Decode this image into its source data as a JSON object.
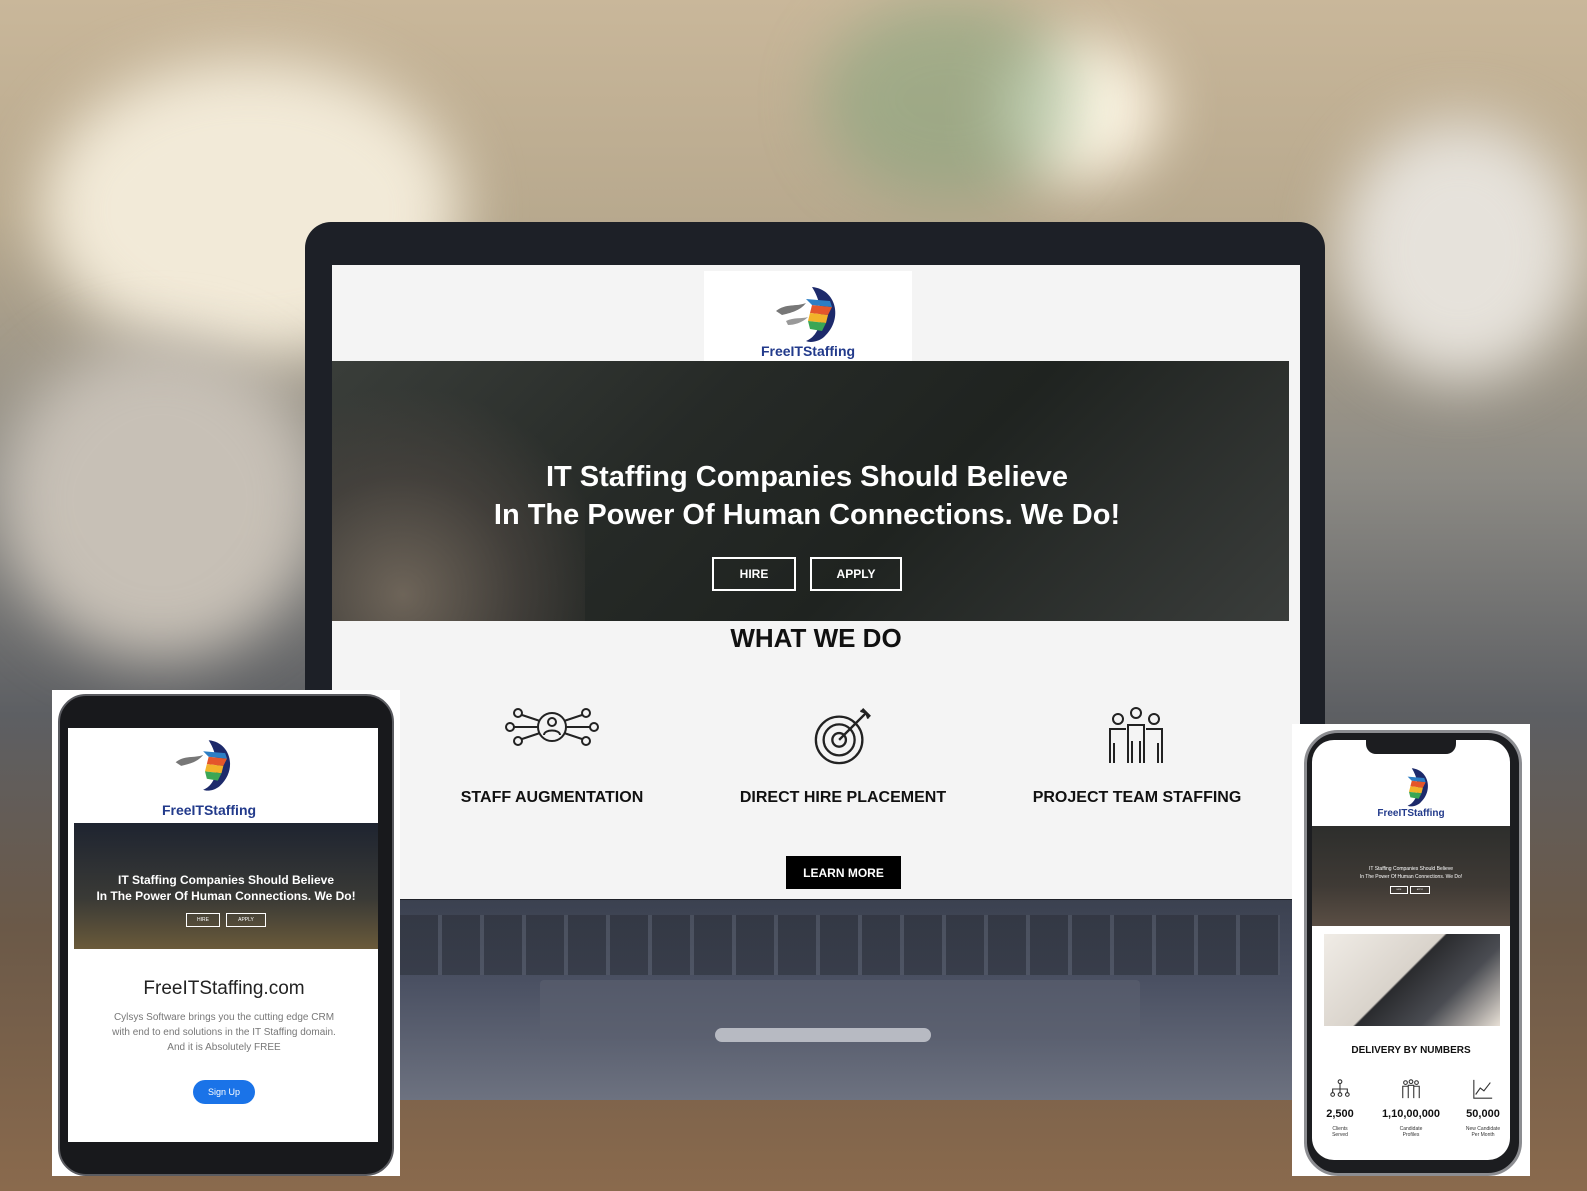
{
  "brand": {
    "name": "FreeITStaffing",
    "colors": {
      "navy": "#223a8b",
      "black": "#000000",
      "blue_button": "#1a73e8"
    }
  },
  "laptop": {
    "hero": {
      "line1": "IT Staffing Companies Should Believe",
      "line2": "In The Power Of Human Connections. We Do!",
      "hire_label": "HIRE",
      "apply_label": "APPLY"
    },
    "section_title": "WHAT WE DO",
    "services": [
      {
        "label": "STAFF AUGMENTATION",
        "icon": "network-person-icon"
      },
      {
        "label": "DIRECT HIRE PLACEMENT",
        "icon": "target-arrow-icon"
      },
      {
        "label": "PROJECT TEAM STAFFING",
        "icon": "team-icon"
      }
    ],
    "learn_more_label": "LEARN MORE"
  },
  "tablet": {
    "hero": {
      "line1": "IT Staffing Companies Should Believe",
      "line2": "In The Power Of Human Connections. We Do!",
      "hire_label": "HIRE",
      "apply_label": "APPLY"
    },
    "site_title": "FreeITStaffing.com",
    "description_line1": "Cylsys Software brings you the cutting edge CRM",
    "description_line2": "with end to end solutions in the IT Staffing domain.",
    "description_line3": "And it is Absolutely FREE",
    "signup_label": "Sign Up"
  },
  "phone": {
    "hero": {
      "line1": "IT Staffing Companies Should Believe",
      "line2": "In The Power Of Human Connections. We Do!",
      "hire_label": "HIRE",
      "apply_label": "APPLY"
    },
    "numbers_title": "DELIVERY BY NUMBERS",
    "stats": [
      {
        "value": "2,500",
        "caption1": "Clients",
        "caption2": "Served",
        "icon": "org-chart-icon"
      },
      {
        "value": "1,10,00,000",
        "caption1": "Candidate",
        "caption2": "Profiles",
        "icon": "people-icon"
      },
      {
        "value": "50,000",
        "caption1": "New Candidate",
        "caption2": "Per Month",
        "icon": "line-chart-icon"
      }
    ]
  }
}
